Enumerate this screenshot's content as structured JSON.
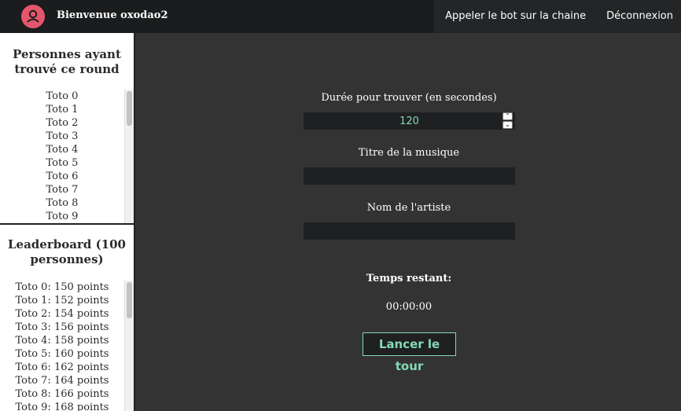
{
  "header": {
    "welcome": "Bienvenue oxodao2",
    "nav": [
      {
        "label": "Appeler le bot sur la chaine"
      },
      {
        "label": "Déconnexion"
      }
    ],
    "colors": {
      "bar": "#1a1c1e",
      "avatar": "#e3566c"
    }
  },
  "sidebar": {
    "found_panel": {
      "title": "Personnes ayant trouvé ce round",
      "items": [
        "Toto 0",
        "Toto 1",
        "Toto 2",
        "Toto 3",
        "Toto 4",
        "Toto 5",
        "Toto 6",
        "Toto 7",
        "Toto 8",
        "Toto 9"
      ]
    },
    "leaderboard": {
      "title": "Leaderboard (100 personnes)",
      "items": [
        "Toto 0: 150 points",
        "Toto 1: 152 points",
        "Toto 2: 154 points",
        "Toto 3: 156 points",
        "Toto 4: 158 points",
        "Toto 5: 160 points",
        "Toto 6: 162 points",
        "Toto 7: 164 points",
        "Toto 8: 166 points",
        "Toto 9: 168 points"
      ]
    }
  },
  "main": {
    "duration_label": "Durée pour trouver (en secondes)",
    "duration_value": "120",
    "title_label": "Titre de la musique",
    "title_value": "",
    "artist_label": "Nom de l'artiste",
    "artist_value": "",
    "remaining_label": "Temps restant:",
    "remaining_value": "00:00:00",
    "start_button": "Lancer le tour",
    "accent": "#84d9b4"
  }
}
